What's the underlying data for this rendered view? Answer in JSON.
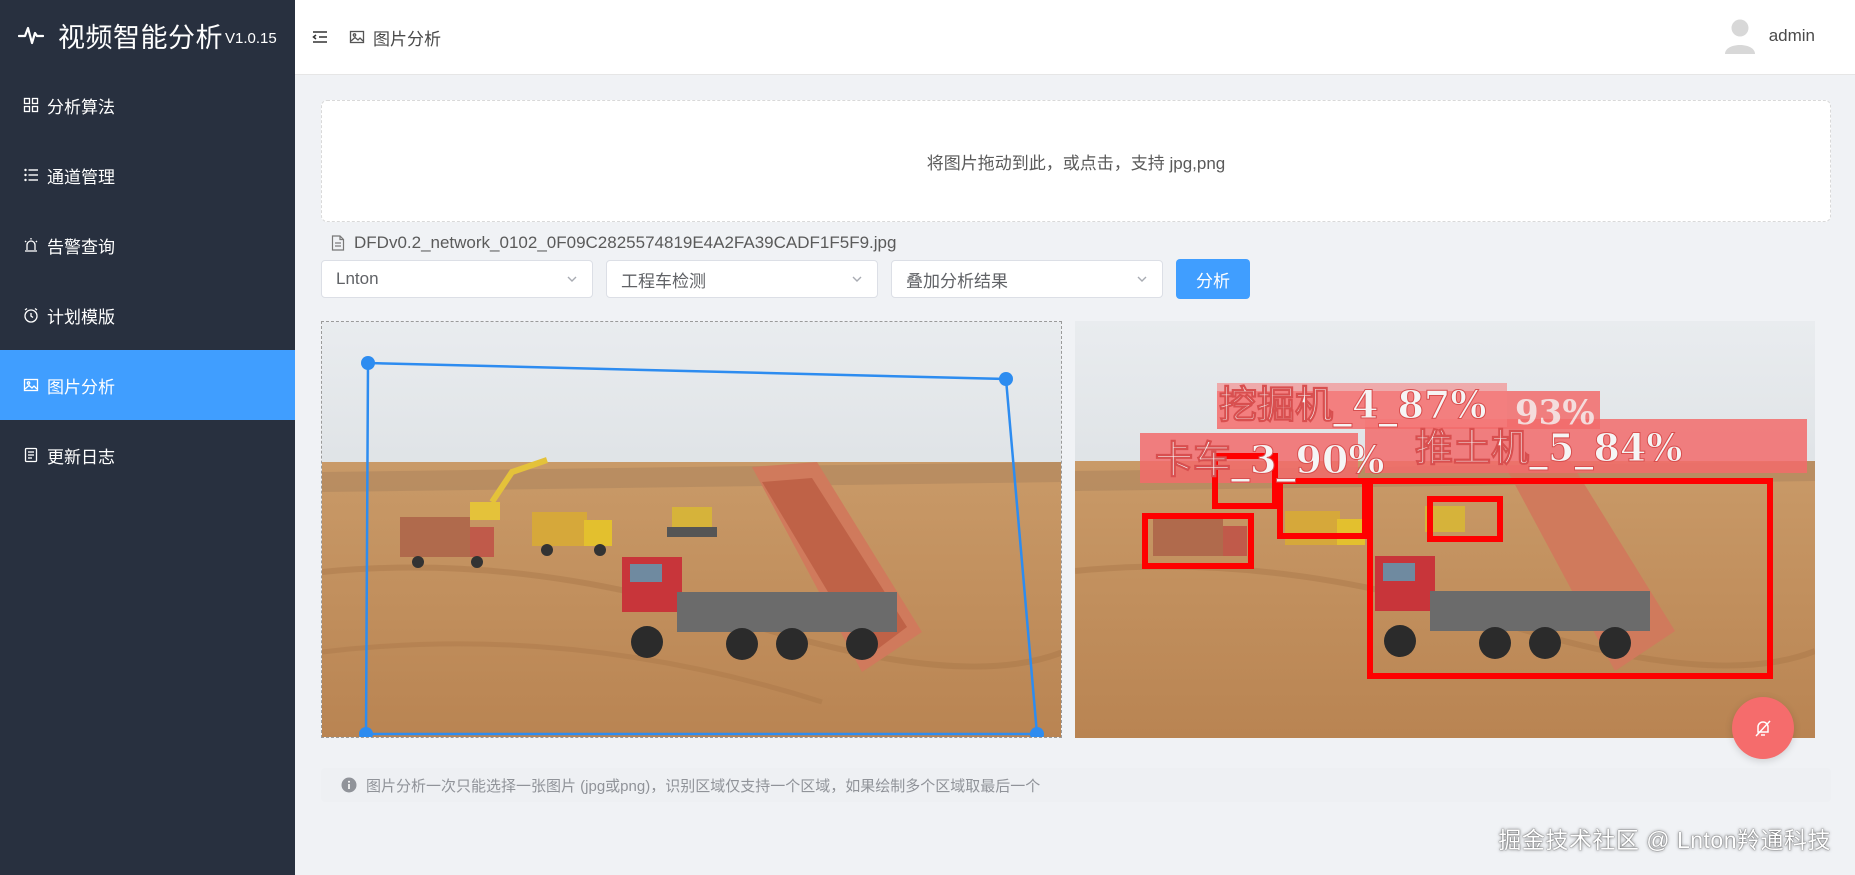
{
  "app": {
    "title": "视频智能分析",
    "version": "V1.0.15"
  },
  "sidebar": {
    "items": [
      {
        "label": "分析算法",
        "icon": "grid-icon"
      },
      {
        "label": "通道管理",
        "icon": "list-icon"
      },
      {
        "label": "告警查询",
        "icon": "alarm-light-icon"
      },
      {
        "label": "计划模版",
        "icon": "clock-icon"
      },
      {
        "label": "图片分析",
        "icon": "picture-icon",
        "active": true
      },
      {
        "label": "更新日志",
        "icon": "document-icon"
      }
    ]
  },
  "header": {
    "breadcrumb": "图片分析",
    "user": "admin"
  },
  "upload": {
    "hint": "将图片拖动到此，或点击，支持 jpg,png"
  },
  "file": {
    "name": "DFDv0.2_network_0102_0F09C2825574819E4A2FA39CADF1F5F9.jpg"
  },
  "controls": {
    "select_channel": "Lnton",
    "select_algorithm": "工程车检测",
    "select_mode": "叠加分析结果",
    "analyze_label": "分析"
  },
  "result": {
    "labels": [
      {
        "text": "挖掘机_4_87%"
      },
      {
        "text": "93%"
      },
      {
        "text": "卡车_3_90%"
      },
      {
        "text": "推土机_5_84%"
      }
    ],
    "box_color": "#ff0000",
    "region_color": "#2d8cf0"
  },
  "tip": {
    "text": "图片分析一次只能选择一张图片 (jpg或png)，识别区域仅支持一个区域，如果绘制多个区域取最后一个"
  },
  "watermark": "掘金技术社区 @ Lnton羚通科技",
  "colors": {
    "sidebar": "#28303f",
    "accent": "#409eff",
    "danger": "#f56c6c"
  }
}
